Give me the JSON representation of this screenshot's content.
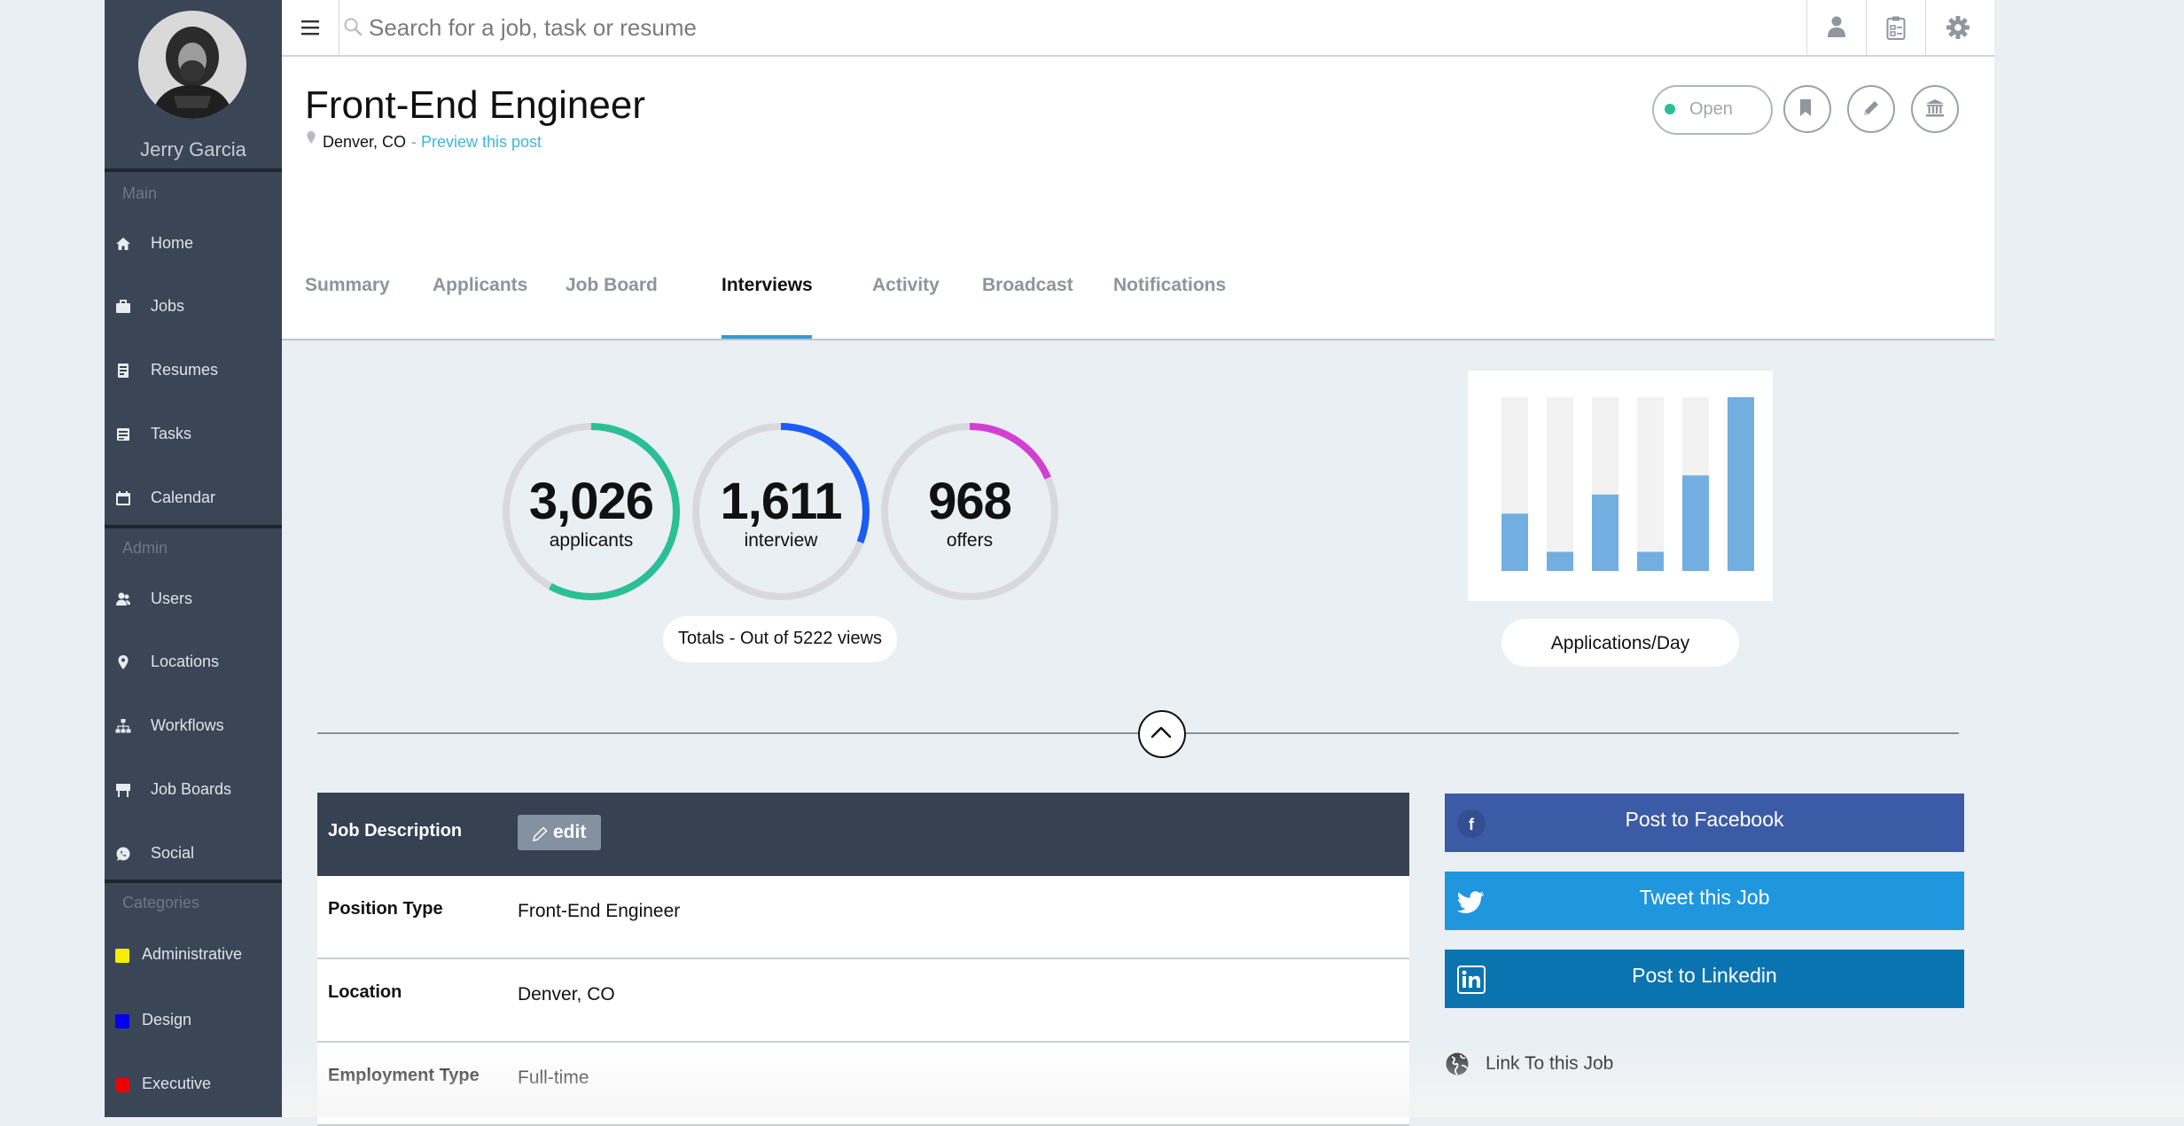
{
  "user": {
    "name": "Jerry Garcia"
  },
  "sidebar": {
    "sections": {
      "main": "Main",
      "admin": "Admin",
      "categories": "Categories"
    },
    "main_items": [
      {
        "label": "Home",
        "icon": "home-icon"
      },
      {
        "label": "Jobs",
        "icon": "briefcase-icon"
      },
      {
        "label": "Resumes",
        "icon": "resume-icon"
      },
      {
        "label": "Tasks",
        "icon": "tasks-icon"
      },
      {
        "label": "Calendar",
        "icon": "calendar-icon"
      }
    ],
    "admin_items": [
      {
        "label": "Users",
        "icon": "users-icon"
      },
      {
        "label": "Locations",
        "icon": "location-pin-icon"
      },
      {
        "label": "Workflows",
        "icon": "workflow-icon"
      },
      {
        "label": "Job Boards",
        "icon": "job-board-icon"
      },
      {
        "label": "Social",
        "icon": "whatsapp-icon"
      }
    ],
    "categories": [
      {
        "label": "Administrative",
        "color": "#f5ee00"
      },
      {
        "label": "Design",
        "color": "#0000ee"
      },
      {
        "label": "Executive",
        "color": "#ee0000"
      }
    ]
  },
  "search": {
    "placeholder": "Search for a job, task or resume"
  },
  "job": {
    "title": "Front-End Engineer",
    "location": "Denver, CO",
    "preview_link": "- Preview this post",
    "status": "Open",
    "status_color": "#2bbf98"
  },
  "tabs": [
    {
      "label": "Summary",
      "active": false
    },
    {
      "label": "Applicants",
      "active": false
    },
    {
      "label": "Job Board",
      "active": false
    },
    {
      "label": "Interviews",
      "active": true
    },
    {
      "label": "Activity",
      "active": false
    },
    {
      "label": "Broadcast",
      "active": false
    },
    {
      "label": "Notifications",
      "active": false
    }
  ],
  "stats": {
    "total_views": 5222,
    "totals_label": "Totals - Out of 5222 views",
    "items": [
      {
        "value": "3,026",
        "label": "applicants",
        "count": 3026,
        "color": "#2bbf98"
      },
      {
        "value": "1,611",
        "label": "interview",
        "count": 1611,
        "color": "#1d5cf2"
      },
      {
        "value": "968",
        "label": "offers",
        "count": 968,
        "color": "#d33ed3"
      }
    ]
  },
  "chart_data": {
    "type": "bar",
    "title": "Applications/Day",
    "values": [
      0.33,
      0.11,
      0.44,
      0.11,
      0.55,
      1.0
    ],
    "bar_color": "#72aee0",
    "track_color": "#f2f2f2"
  },
  "details": {
    "header": "Job Description",
    "edit_label": "edit",
    "rows": [
      {
        "key": "Position Type",
        "value": "Front-End Engineer"
      },
      {
        "key": "Location",
        "value": "Denver, CO"
      },
      {
        "key": "Employment Type",
        "value": "Full-time"
      }
    ]
  },
  "share": {
    "facebook": {
      "label": "Post to Facebook",
      "color": "#3b5ba6",
      "icon_bg": "#334f92"
    },
    "twitter": {
      "label": "Tweet this Job",
      "color": "#1f96de"
    },
    "linkedin": {
      "label": "Post to Linkedin",
      "color": "#0a74b0"
    },
    "link": {
      "label": "Link To this Job"
    }
  }
}
